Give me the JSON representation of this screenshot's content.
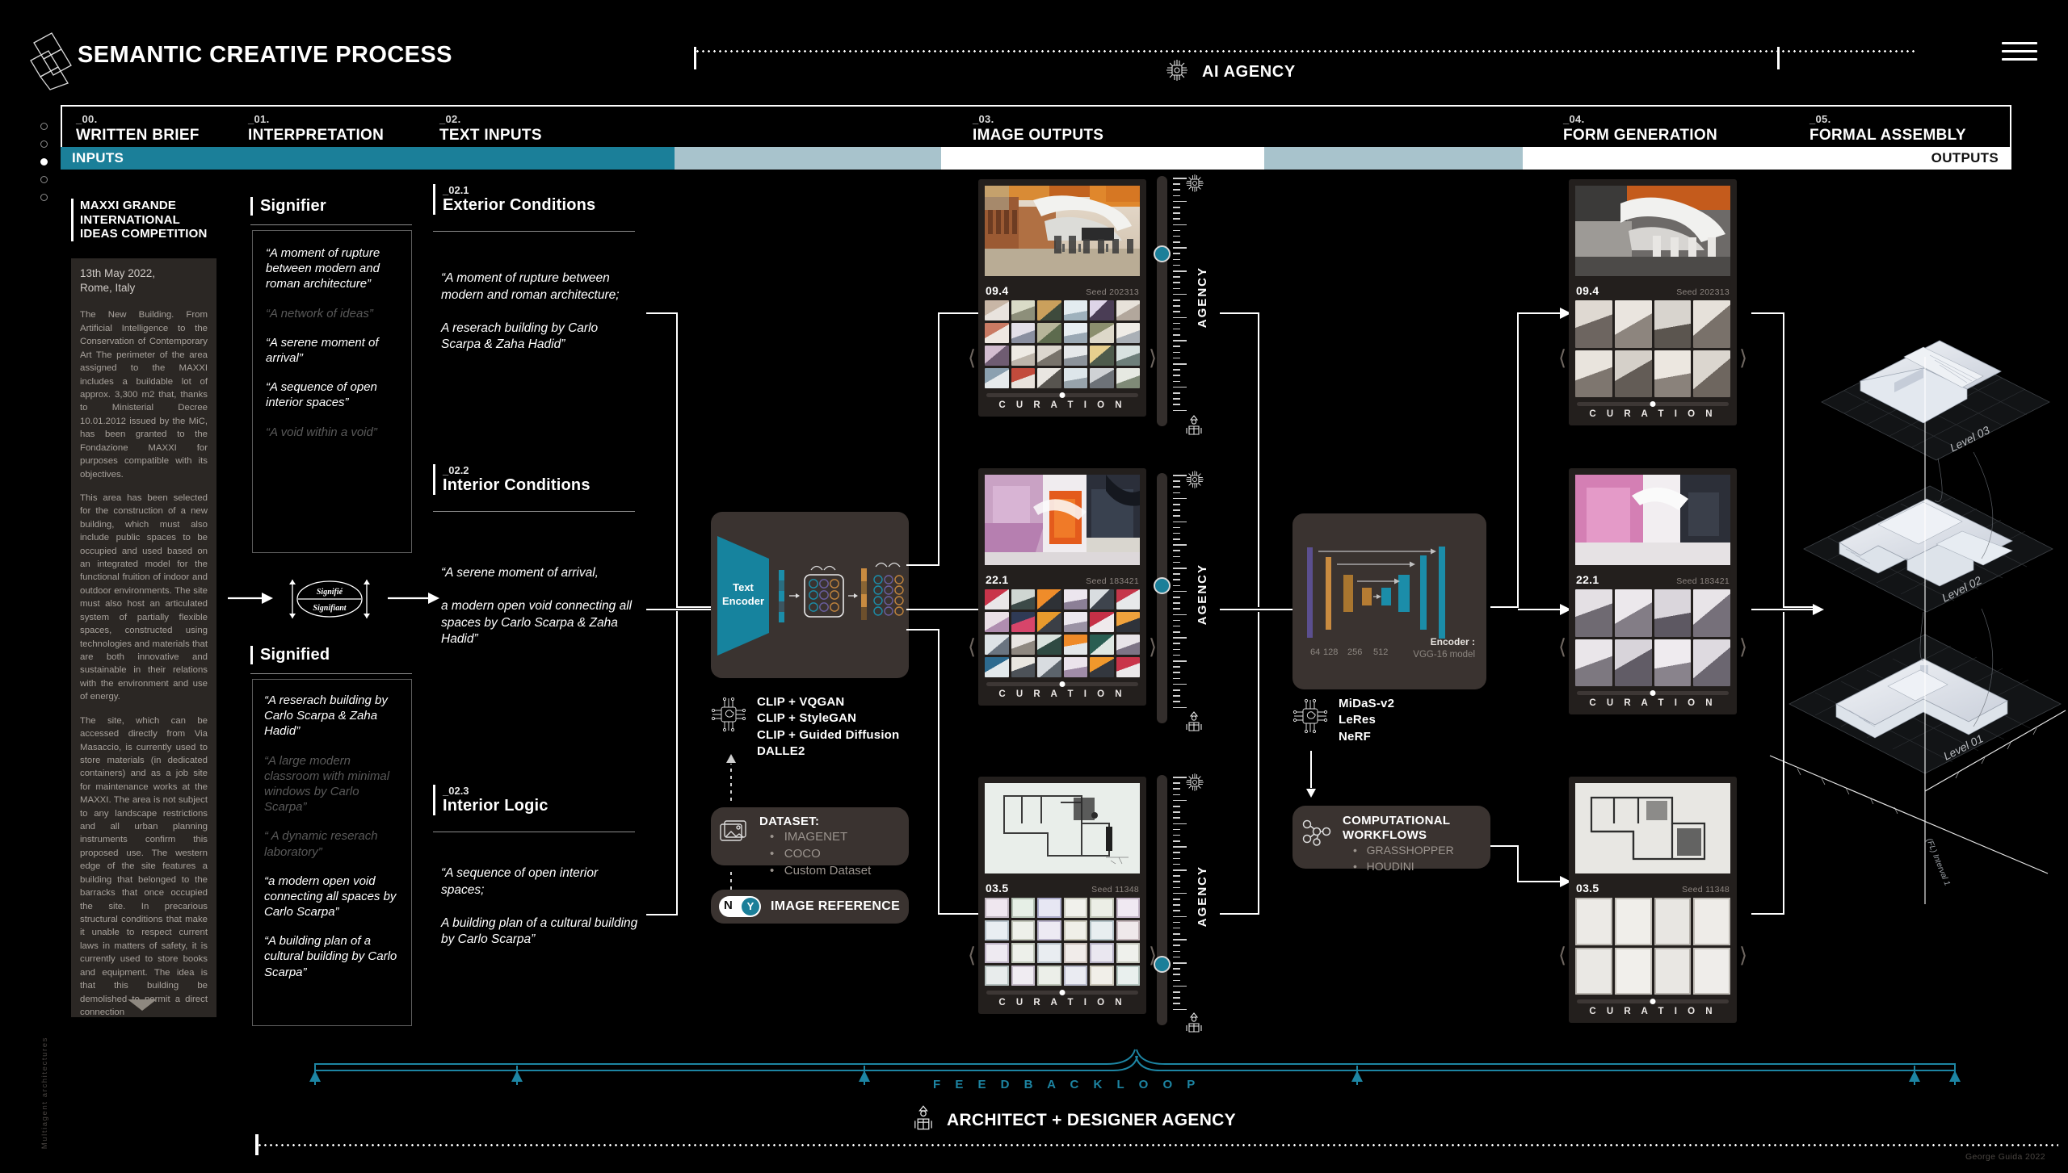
{
  "header": {
    "title": "SEMANTIC CREATIVE PROCESS",
    "ai_agency_label": "AI AGENCY",
    "logo_icon": "isometric-diamond-logo",
    "menu_icon": "hamburger-icon",
    "ai_icon": "ai-chip-icon"
  },
  "phases": [
    {
      "num": "_00.",
      "name": "WRITTEN BRIEF"
    },
    {
      "num": "_01.",
      "name": "INTERPRETATION"
    },
    {
      "num": "_02.",
      "name": "TEXT INPUTS"
    },
    {
      "num": "_03.",
      "name": "IMAGE OUTPUTS"
    },
    {
      "num": "_04.",
      "name": "FORM GENERATION"
    },
    {
      "num": "_05.",
      "name": "FORMAL ASSEMBLY"
    }
  ],
  "bands": {
    "inputs_label": "INPUTS",
    "outputs_label": "OUTPUTS",
    "accent": "#1b7f99",
    "mid": "#a8c3cc",
    "light": "#ffffff",
    "pale": "#c9d8dd"
  },
  "brief": {
    "title": "MAXXI  GRANDE INTERNATIONAL IDEAS COMPETITION",
    "date": "13th May 2022,\nRome, Italy",
    "paragraphs": [
      "The New Building. From Artificial Intelligence to the Conservation of Contemporary Art The perimeter of the area assigned to the MAXXI includes a buildable lot of approx. 3,300 m2 that, thanks to Ministerial Decree 10.01.2012 issued by the MiC, has been granted to the Fondazione MAXXI for purposes compatible with its objectives.",
      "This area has been selected for the construction of a new building, which must also include public spaces to be occupied and used based on an integrated model for the functional fruition of indoor and outdoor environments. The site must also host an articulated system of partially flexible spaces, constructed using technologies and materials that are both innovative and sustainable in their relations with the environment and use of energy.",
      "The site, which can be accessed directly from Via Masaccio, is currently used to store materials (in dedicated containers) and as a job site for maintenance works at the MAXXI. The area is not subject to any landscape restrictions and all urban planning instruments confirm this proposed use. The western edge of the site features a building that belonged to the barracks that once occupied the site. In precarious structural conditions that make it unable to respect current laws in matters of safety, it is currently used to store books and equipment. The idea is that this building be demolished to permit a direct connection"
    ],
    "scroll_icon": "scroll-down-arrow-icon"
  },
  "signifier": {
    "heading": "Signifier",
    "items": [
      {
        "text": "“A moment of rupture between modern and roman architecture”",
        "dim": false
      },
      {
        "text": "“A network of ideas”",
        "dim": true
      },
      {
        "text": "“A serene moment of arrival”",
        "dim": false
      },
      {
        "text": "“A sequence of open interior spaces”",
        "dim": false
      },
      {
        "text": "“A void within a void”",
        "dim": true
      }
    ]
  },
  "signified": {
    "heading": "Signified",
    "items": [
      {
        "text": "“A reserach building by Carlo Scarpa & Zaha Hadid”",
        "dim": false
      },
      {
        "text": "“A large modern classroom with minimal windows by Carlo Scarpa”",
        "dim": true
      },
      {
        "text": "“ A dynamic reserach laboratory”",
        "dim": true
      },
      {
        "text": "“a modern open void connecting all spaces by Carlo Scarpa”",
        "dim": false
      },
      {
        "text": "“A building plan of a cultural building by Carlo Scarpa”",
        "dim": false
      }
    ]
  },
  "semiotic_diagram": {
    "top_word": "Signifié",
    "bottom_word": "Signifiant",
    "icon": "semiotic-ellipse-icon"
  },
  "text_inputs": [
    {
      "num": "_02.1",
      "title": "Exterior Conditions",
      "prompt": "“A moment of rupture between modern and roman architecture;\n\nA reserach building by Carlo Scarpa & Zaha Hadid”"
    },
    {
      "num": "_02.2",
      "title": "Interior Conditions",
      "prompt": "“A serene moment of arrival,\n\na modern open void connecting all spaces by Carlo Scarpa & Zaha Hadid”"
    },
    {
      "num": "_02.3",
      "title": "Interior Logic",
      "prompt": "“A sequence of open interior spaces;\n\nA building plan of a cultural building by Carlo Scarpa”"
    }
  ],
  "text_encoder": {
    "label": "Text\nEncoder",
    "label_line1": "Text",
    "label_line2": "Encoder",
    "models": [
      "CLIP + VQGAN",
      "CLIP + StyleGAN",
      "CLIP + Guided Diffusion",
      "DALLE2"
    ],
    "models_icon": "ai-chip-brain-icon",
    "dataset_title": "DATASET:",
    "dataset_items": [
      "IMAGENET",
      "COCO",
      "Custom Dataset"
    ],
    "dataset_icon": "images-stack-icon",
    "image_reference_label": "IMAGE REFERENCE",
    "toggle_no": "N",
    "toggle_yes": "Y",
    "toggle_state": "Y"
  },
  "outputs": {
    "curation_label": "C U R A T I O N",
    "panels": [
      {
        "id": "09.4",
        "seed": "Seed 202313",
        "kind": "exterior"
      },
      {
        "id": "22.1",
        "seed": "Seed 183421",
        "kind": "interior"
      },
      {
        "id": "03.5",
        "seed": "Seed 11348",
        "kind": "plan"
      }
    ]
  },
  "agency_sliders": {
    "label": "AGENCY",
    "top_icon": "ai-chip-icon",
    "bottom_icon": "architect-person-icon",
    "knob_color": "#1b7f99",
    "count": 3
  },
  "depth_model": {
    "layer_labels": [
      "64",
      "128",
      "256",
      "512"
    ],
    "encoder_line1": "Encoder :",
    "encoder_line2": "VGG-16 model",
    "models": [
      "MiDaS-v2",
      "LeRes",
      "NeRF"
    ],
    "models_icon": "ai-chip-brain-icon"
  },
  "computational_workflows": {
    "title_line1": "COMPUTATIONAL",
    "title_line2": "WORKFLOWS",
    "items": [
      "GRASSHOPPER",
      "HOUDINI"
    ],
    "icon": "node-graph-icon"
  },
  "form_generation": {
    "curation_label": "C U R A T I O N",
    "panels": [
      {
        "id": "09.4",
        "seed": "Seed 202313",
        "kind": "exterior-depth"
      },
      {
        "id": "22.1",
        "seed": "Seed 183421",
        "kind": "interior-depth"
      },
      {
        "id": "03.5",
        "seed": "Seed 11348",
        "kind": "plan-depth"
      }
    ]
  },
  "assembly": {
    "levels": [
      "Level 03",
      "Level 02",
      "Level 01"
    ],
    "axis_note": "(FL) Interval 1"
  },
  "footer": {
    "feedback_label": "F E E D B A C K   L O O P",
    "feedback_color": "#1d85a3",
    "architect_label": "ARCHITECT + DESIGNER AGENCY",
    "architect_icon": "architect-person-icon",
    "credit": "George Guida 2022",
    "side_credit": "Multiagent architectures"
  }
}
